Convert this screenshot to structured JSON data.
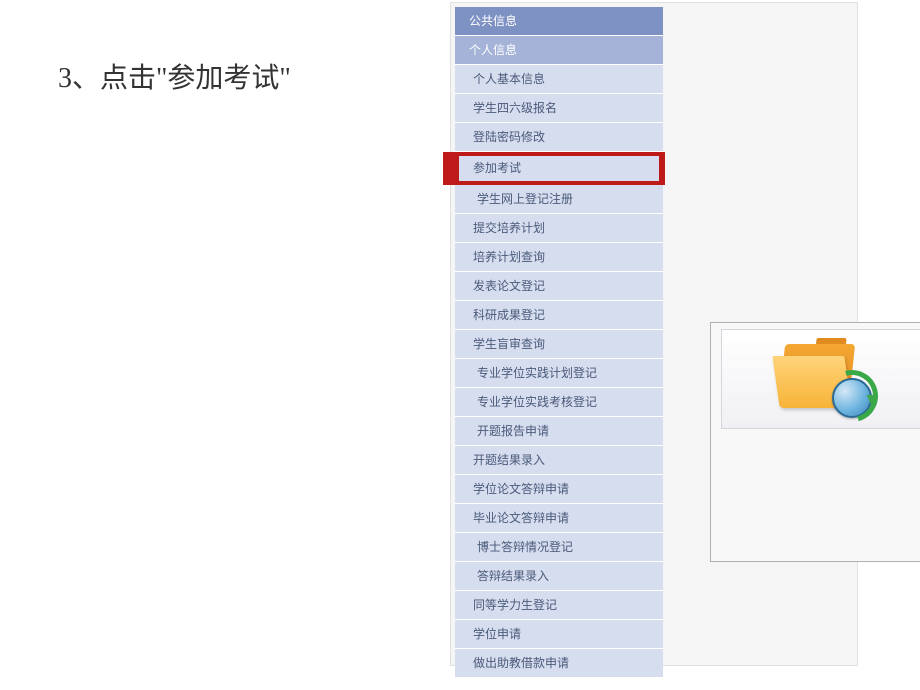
{
  "instruction": "3、点击\"参加考试\"",
  "sidebar": {
    "headers": {
      "public_info": "公共信息",
      "personal_info": "个人信息"
    },
    "items": [
      {
        "label": "个人基本信息"
      },
      {
        "label": "学生四六级报名"
      },
      {
        "label": "登陆密码修改"
      },
      {
        "label": "参加考试",
        "highlighted": true
      },
      {
        "label": "学生网上登记注册"
      },
      {
        "label": "提交培养计划"
      },
      {
        "label": "培养计划查询"
      },
      {
        "label": "发表论文登记"
      },
      {
        "label": "科研成果登记"
      },
      {
        "label": "学生盲审查询"
      },
      {
        "label": "专业学位实践计划登记"
      },
      {
        "label": "专业学位实践考核登记"
      },
      {
        "label": "开题报告申请"
      },
      {
        "label": "开题结果录入"
      },
      {
        "label": "学位论文答辩申请"
      },
      {
        "label": "毕业论文答辩申请"
      },
      {
        "label": "博士答辩情况登记"
      },
      {
        "label": "答辩结果录入"
      },
      {
        "label": "同等学力生登记"
      },
      {
        "label": "学位申请"
      },
      {
        "label": "做出助教借款申请"
      }
    ]
  }
}
